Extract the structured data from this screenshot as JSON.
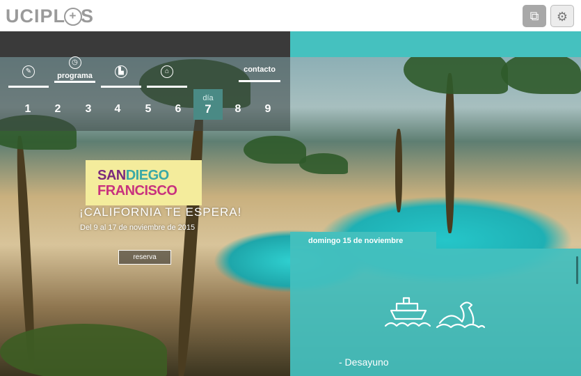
{
  "app": {
    "logo_left": "UCIPL",
    "logo_plus": "+",
    "logo_right": "S"
  },
  "toolbar": {
    "button1_icon": "chat-icon",
    "button2_icon": "settings-icon"
  },
  "nav": {
    "items": [
      {
        "icon": "compass-icon",
        "label": ""
      },
      {
        "icon": "clock-icon",
        "label": "programa"
      },
      {
        "icon": "grid-icon",
        "label": ""
      },
      {
        "icon": "home-icon",
        "label": ""
      },
      {
        "icon": "",
        "label": "contacto"
      }
    ]
  },
  "days": {
    "label": "día",
    "items": [
      "1",
      "2",
      "3",
      "4",
      "5",
      "6",
      "7",
      "8",
      "9"
    ],
    "selected": "7"
  },
  "promo": {
    "line1a": "SAN",
    "line1b": "DIEGO",
    "line2": "FRANCISCO",
    "tagline": "¡CALIFORNIA TE ESPERA!",
    "dates": "Del 9 al 17 de noviembre de 2015",
    "button": "reserva"
  },
  "panel": {
    "date": "domingo 15 de noviembre",
    "activity": "- Desayuno",
    "icon": "boat-whale-icon"
  }
}
